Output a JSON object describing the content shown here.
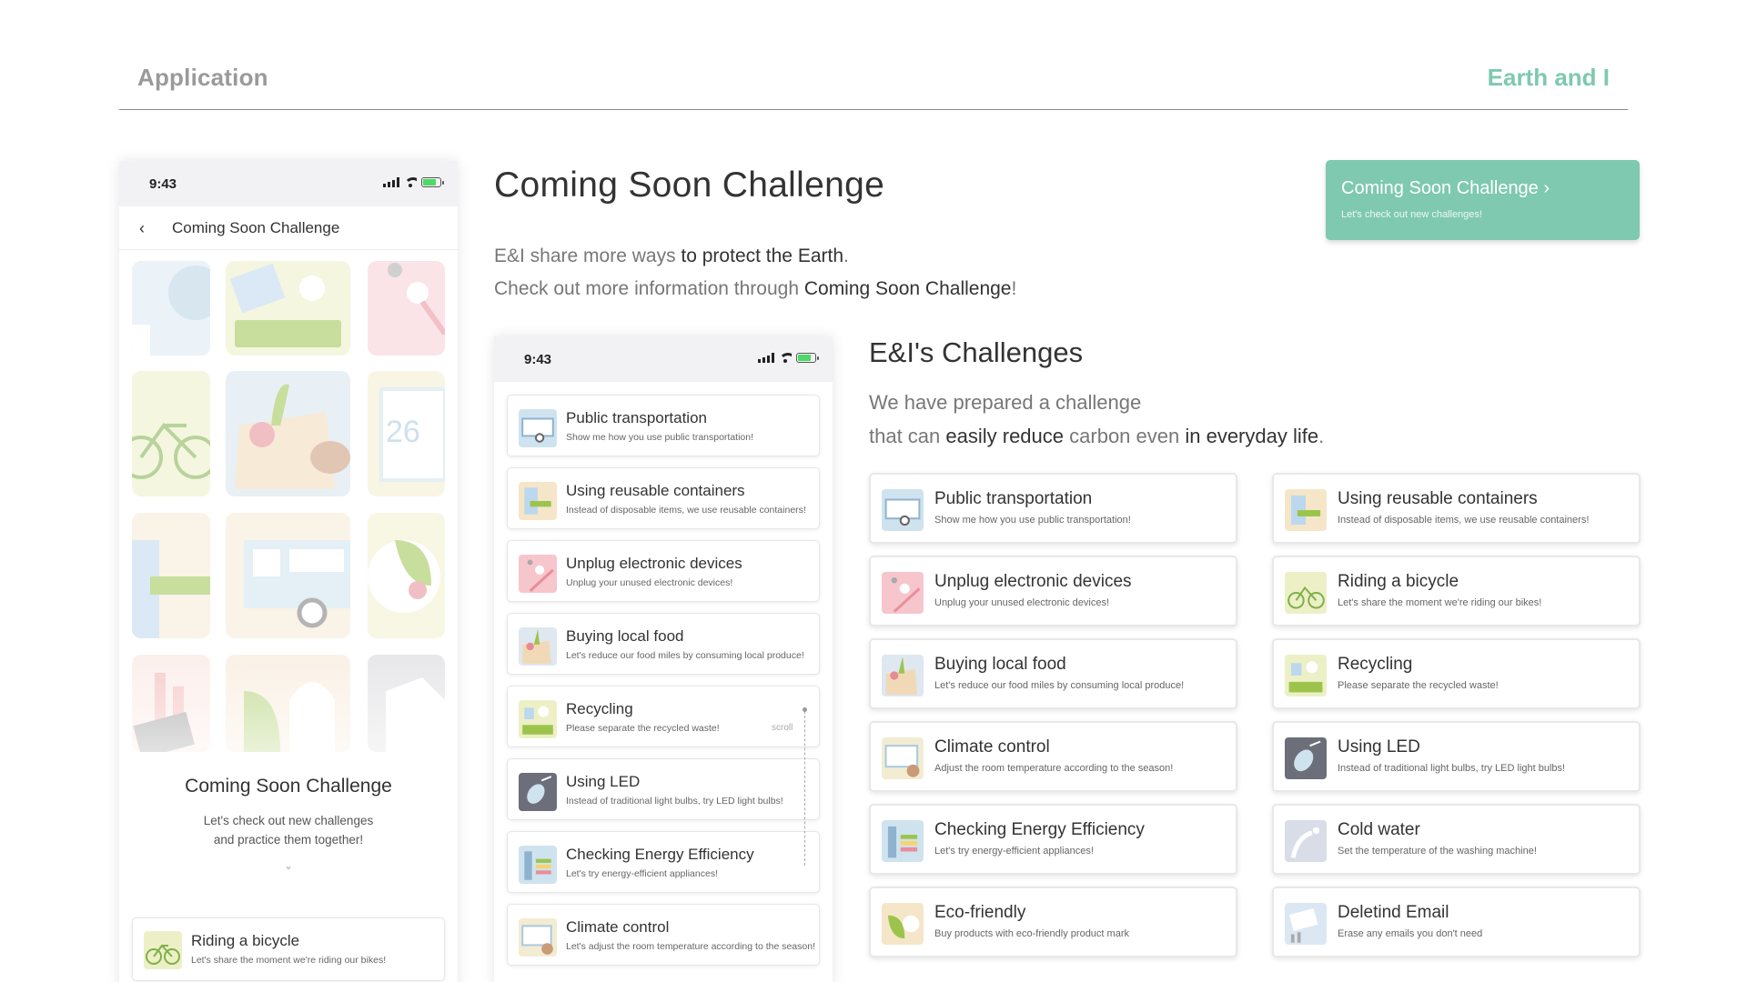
{
  "header": {
    "left": "Application",
    "right": "Earth and I"
  },
  "status": {
    "time": "9:43"
  },
  "phone1": {
    "nav_back": "‹",
    "nav_title": "Coming Soon Challenge",
    "title": "Coming Soon Challenge",
    "desc_line1": "Let's check out new challenges",
    "desc_line2": "and practice them together!",
    "chevron": "⌄",
    "card": {
      "title": "Riding a bicycle",
      "desc": "Let's share the moment we're riding our bikes!"
    }
  },
  "main": {
    "title": "Coming Soon Challenge",
    "desc_a": "E&I share more ways ",
    "desc_b": "to protect the Earth",
    "desc_c": ".",
    "desc_d": "Check out more information through ",
    "desc_e": "Coming Soon Challenge",
    "desc_f": "!"
  },
  "cta": {
    "title": "Coming Soon Challenge  ›",
    "sub": "Let's check out new challenges!"
  },
  "phone2": {
    "scroll": "scroll",
    "items": [
      {
        "title": "Public transportation",
        "desc": "Show me how you use public transportation!",
        "icon": "bus-icon",
        "color": "#cfe3ef"
      },
      {
        "title": "Using reusable containers",
        "desc": "Instead of disposable items, we use reusable containers!",
        "icon": "container-icon",
        "color": "#f5e6c9"
      },
      {
        "title": "Unplug electronic devices",
        "desc": "Unplug your unused electronic devices!",
        "icon": "plug-icon",
        "color": "#f6c6cc"
      },
      {
        "title": "Buying local food",
        "desc": "Let's reduce our food miles by consuming local produce!",
        "icon": "food-icon",
        "color": "#dfe7f0"
      },
      {
        "title": "Recycling",
        "desc": "Please separate the recycled waste!",
        "icon": "recycle-icon",
        "color": "#edf0c6"
      },
      {
        "title": "Using LED",
        "desc": "Instead of traditional light bulbs, try LED light bulbs!",
        "icon": "led-icon",
        "color": "#6c6f7a"
      },
      {
        "title": "Checking Energy Efficiency",
        "desc": "Let's try energy-efficient appliances!",
        "icon": "energy-icon",
        "color": "#cfe3ef"
      },
      {
        "title": "Climate control",
        "desc": "Let's adjust the room temperature according to the season!",
        "icon": "thermo-icon",
        "color": "#f2ecd2"
      }
    ]
  },
  "section": {
    "title": "E&I's Challenges",
    "desc_a": "We have prepared a challenge",
    "desc_b": "that can ",
    "desc_c": "easily reduce",
    "desc_d": " carbon even ",
    "desc_e": "in everyday life",
    "desc_f": "."
  },
  "challenges": [
    {
      "title": "Public transportation",
      "desc": "Show me how you use public transportation!",
      "icon": "bus-icon",
      "color": "#cfe3ef"
    },
    {
      "title": "Using reusable containers",
      "desc": "Instead of disposable items, we use reusable containers!",
      "icon": "container-icon",
      "color": "#f5e6c9"
    },
    {
      "title": "Unplug electronic devices",
      "desc": "Unplug your unused electronic devices!",
      "icon": "plug-icon",
      "color": "#f6c6cc"
    },
    {
      "title": "Riding a bicycle",
      "desc": "Let's share the moment we're riding our bikes!",
      "icon": "bicycle-icon",
      "color": "#edf0c6"
    },
    {
      "title": "Buying local food",
      "desc": "Let's reduce our food miles by consuming local produce!",
      "icon": "food-icon",
      "color": "#dfe7f0"
    },
    {
      "title": "Recycling",
      "desc": "Please separate the recycled waste!",
      "icon": "recycle-icon",
      "color": "#edf0c6"
    },
    {
      "title": "Climate control",
      "desc": "Adjust the room temperature according to the season!",
      "icon": "thermo-icon",
      "color": "#f2ecd2"
    },
    {
      "title": "Using LED",
      "desc": "Instead of traditional light bulbs, try LED light bulbs!",
      "icon": "led-icon",
      "color": "#6c6f7a"
    },
    {
      "title": "Checking Energy Efficiency",
      "desc": "Let's try energy-efficient appliances!",
      "icon": "energy-icon",
      "color": "#cfe3ef"
    },
    {
      "title": "Cold water",
      "desc": "Set the temperature of the washing machine!",
      "icon": "water-icon",
      "color": "#d8dde8"
    },
    {
      "title": "Eco-friendly",
      "desc": "Buy products with eco-friendly product mark",
      "icon": "leaf-icon",
      "color": "#f5e6c9"
    },
    {
      "title": "Deletind Email",
      "desc": "Erase any emails you don't need",
      "icon": "email-icon",
      "color": "#dbe8f3"
    }
  ]
}
